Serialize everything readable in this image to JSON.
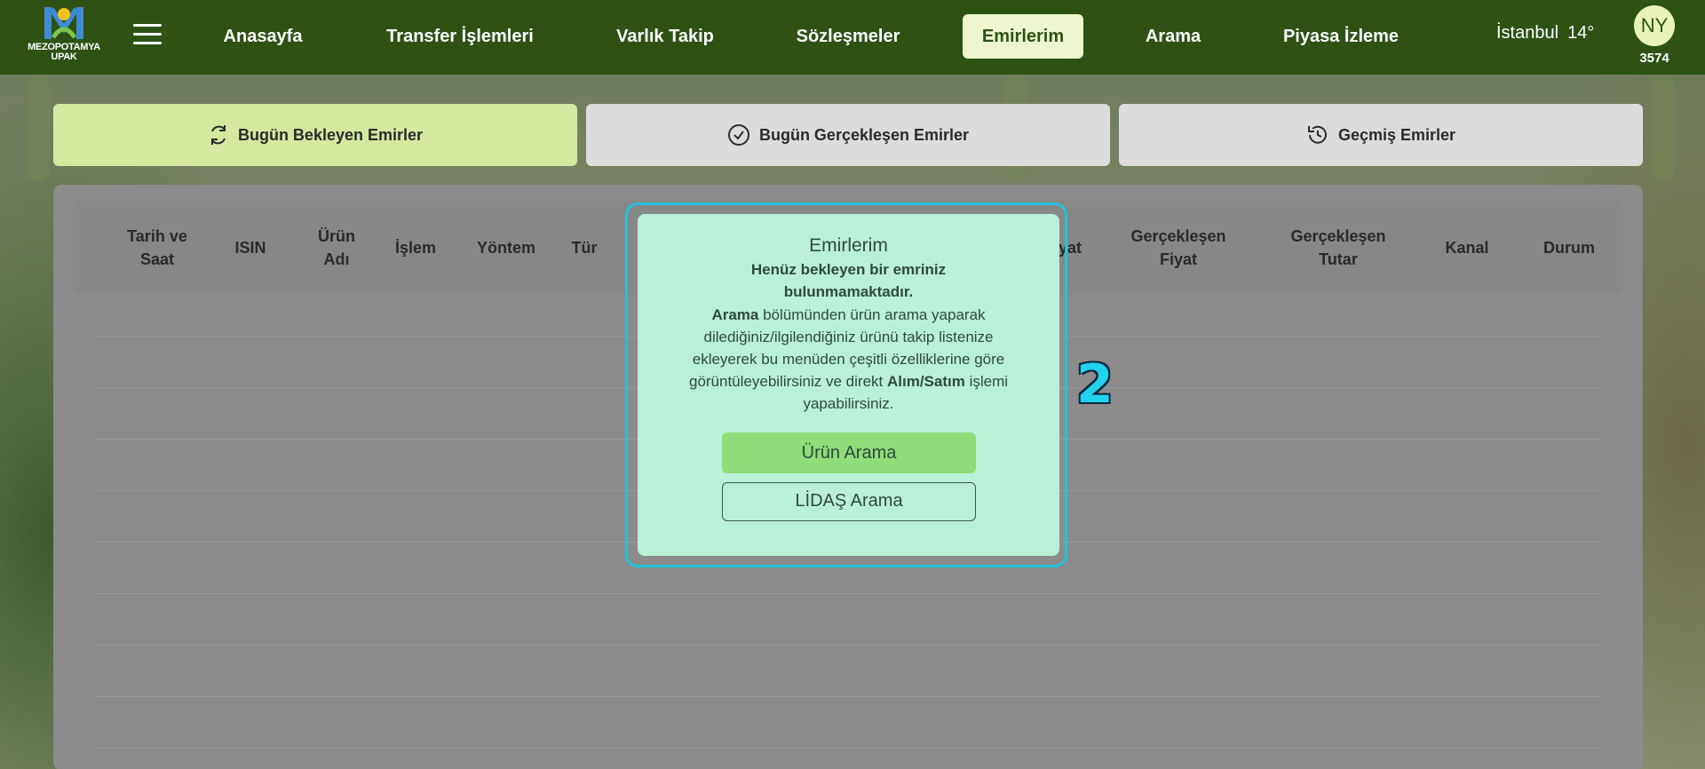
{
  "brand": {
    "logo_line1": "MEZOPOTAMYA",
    "logo_line2": "UPAK"
  },
  "nav": {
    "items": [
      {
        "label": "Anasayfa"
      },
      {
        "label": "Transfer İşlemleri"
      },
      {
        "label": "Varlık Takip"
      },
      {
        "label": "Sözleşmeler"
      },
      {
        "label": "Emirlerim"
      },
      {
        "label": "Arama"
      },
      {
        "label": "Piyasa İzleme"
      }
    ],
    "active": "Emirlerim"
  },
  "weather": {
    "city": "İstanbul",
    "temp": "14°"
  },
  "user": {
    "initials": "NY",
    "number": "3574"
  },
  "tabs": [
    {
      "label": "Bugün Bekleyen Emirler",
      "icon": "refresh-icon"
    },
    {
      "label": "Bugün Gerçekleşen Emirler",
      "icon": "check-circle-icon"
    },
    {
      "label": "Geçmiş Emirler",
      "icon": "history-icon"
    }
  ],
  "table": {
    "headers": [
      "Tarih ve Saat",
      "ISIN",
      "Ürün Adı",
      "İşlem",
      "Yöntem",
      "Tür",
      "Fiyat",
      "Gerçekleşen Fiyat",
      "Gerçekleşen Tutar",
      "Kanal",
      "Durum"
    ]
  },
  "modal": {
    "title": "Emirlerim",
    "subtitle": "Henüz bekleyen bir emriniz bulunmamaktadır.",
    "body_bold1": "Arama",
    "body_text1": " bölümünden ürün arama yaparak dilediğiniz/ilgilendiğiniz ürünü takip listenize ekleyerek bu menüden çeşitli özelliklerine göre görüntüleyebilirsiniz ve direkt ",
    "body_bold2": "Alım/Satım",
    "body_text2": " işlemi yapabilirsiniz.",
    "primary_button": "Ürün Arama",
    "secondary_button": "LİDAŞ Arama"
  },
  "step_number": "2",
  "colors": {
    "nav_bg": "#2d5214",
    "active_tab": "#d5e8a0",
    "modal_bg": "#b9f0d7",
    "highlight": "#22c3dc",
    "primary_button": "#8fdc78"
  }
}
